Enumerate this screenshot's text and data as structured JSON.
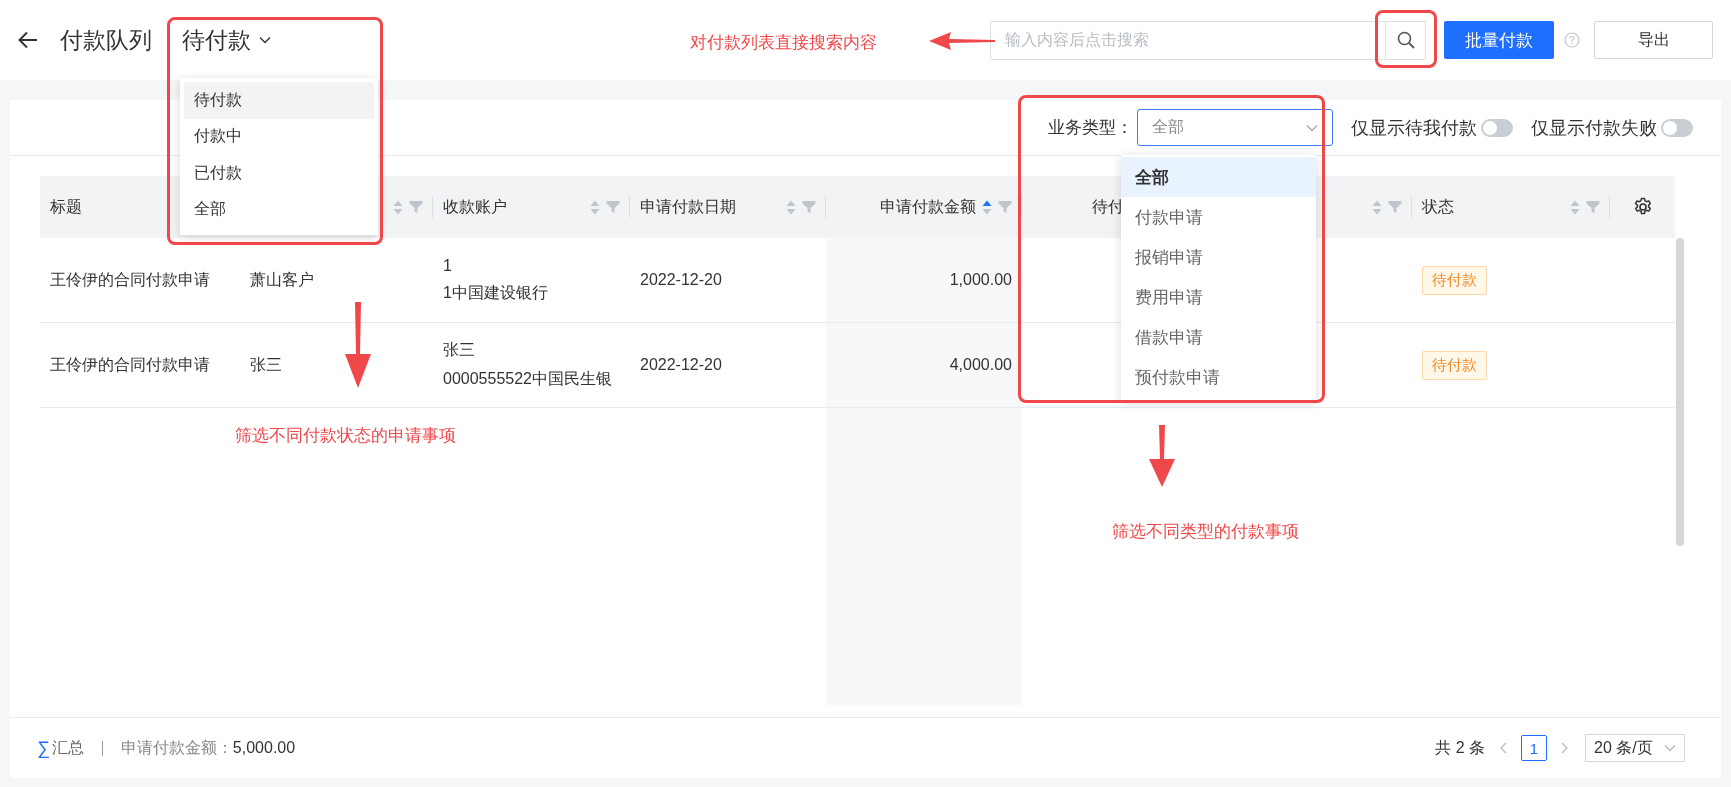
{
  "header": {
    "title": "付款队列",
    "status_filter": {
      "value": "待付款",
      "options": [
        {
          "label": "待付款",
          "selected": true
        },
        {
          "label": "付款中",
          "selected": false
        },
        {
          "label": "已付款",
          "selected": false
        },
        {
          "label": "全部",
          "selected": false
        }
      ]
    },
    "search": {
      "placeholder": "输入内容后点击搜索"
    },
    "primary_button": "批量付款",
    "export_button": "导出"
  },
  "filters": {
    "business_type": {
      "label": "业务类型：",
      "value": "全部",
      "options": [
        {
          "label": "全部",
          "selected": true
        },
        {
          "label": "付款申请",
          "selected": false
        },
        {
          "label": "报销申请",
          "selected": false
        },
        {
          "label": "费用申请",
          "selected": false
        },
        {
          "label": "借款申请",
          "selected": false
        },
        {
          "label": "预付款申请",
          "selected": false
        }
      ]
    },
    "toggles": [
      {
        "label": "仅显示待我付款",
        "on": false
      },
      {
        "label": "仅显示付款失败",
        "on": false
      }
    ]
  },
  "table": {
    "columns": [
      {
        "kind": "text",
        "label": "标题",
        "sortable": false,
        "filterable": false
      },
      {
        "kind": "text",
        "sortable": true,
        "sort_active": false,
        "filterable": true
      },
      {
        "kind": "text",
        "label": "收款账户",
        "sortable": true,
        "sort_active": false,
        "filterable": true
      },
      {
        "kind": "text",
        "label": "申请付款日期",
        "sortable": true,
        "sort_active": false,
        "filterable": true
      },
      {
        "kind": "amount",
        "label": "申请付款金额",
        "sortable": true,
        "sort_active": true,
        "filterable": true
      },
      {
        "kind": "amount",
        "label": "待付",
        "sortable": false,
        "filterable": false
      },
      {
        "kind": "text",
        "sortable": true,
        "sort_active": false,
        "filterable": true
      },
      {
        "kind": "text",
        "label": "状态",
        "sortable": true,
        "sort_active": false,
        "filterable": true
      },
      {
        "kind": "settings"
      }
    ],
    "rows": [
      {
        "title": "王伶伊的合同付款申请",
        "payee": "萧山客户",
        "account": [
          "1",
          "1中国建设银行"
        ],
        "date": "2022-12-20",
        "amount": "1,000.00",
        "status": {
          "label": "待付款",
          "kind": "pending"
        }
      },
      {
        "title": "王伶伊的合同付款申请",
        "payee": "张三",
        "account": [
          "张三",
          "0000555522中国民生银"
        ],
        "date": "2022-12-20",
        "amount": "4,000.00",
        "status": {
          "label": "待付款",
          "kind": "pending"
        }
      }
    ]
  },
  "footer": {
    "summary": {
      "icon": "∑",
      "label": "汇总",
      "amount_label": "申请付款金额：",
      "amount": "5,000.00"
    },
    "pagination": {
      "total": "共 2 条",
      "pages": [
        {
          "label": "1",
          "selected": true
        }
      ],
      "page_size": "20 条/页"
    }
  },
  "annotations": {
    "search_note": "对付款列表直接搜索内容",
    "status_note": "筛选不同付款状态的申请事项",
    "type_note": "筛选不同类型的付款事项"
  }
}
